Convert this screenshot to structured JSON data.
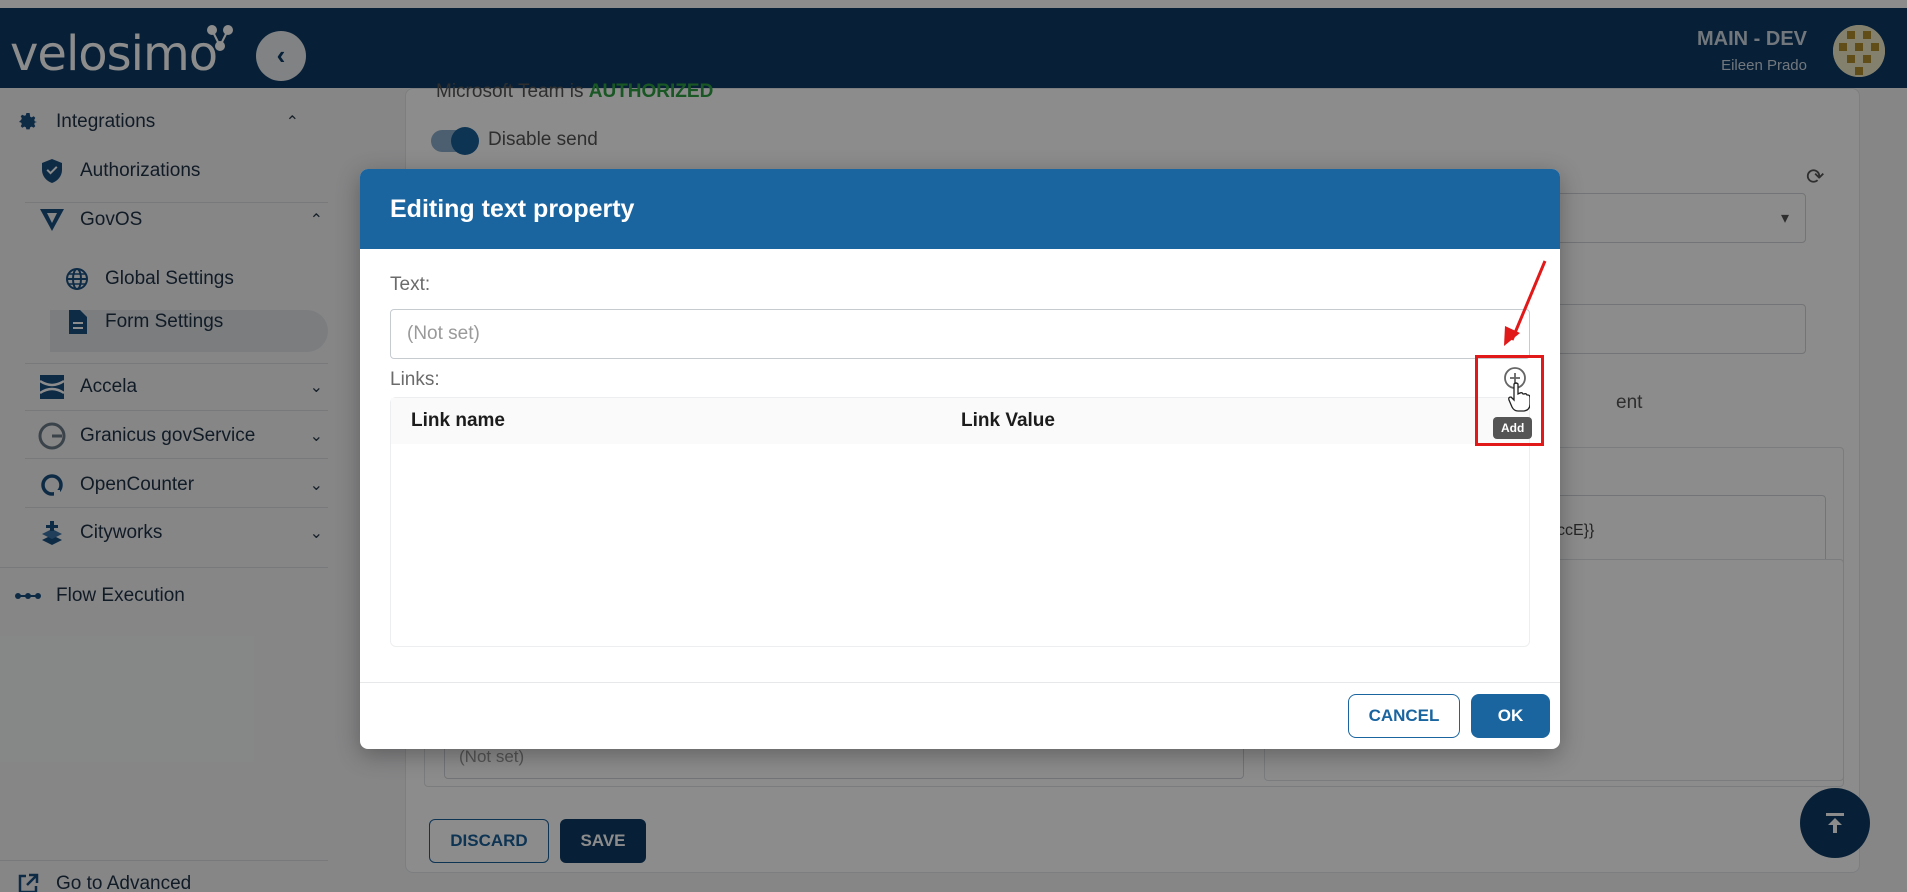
{
  "app": {
    "brand": "velosimo",
    "env_name": "MAIN - DEV",
    "user_name": "Eileen Prado"
  },
  "sidebar": {
    "integrations_label": "Integrations",
    "authorizations_label": "Authorizations",
    "govos_label": "GovOS",
    "global_settings_label": "Global Settings",
    "form_settings_label": "Form Settings",
    "accela_label": "Accela",
    "granicus_label": "Granicus govService",
    "opencounter_label": "OpenCounter",
    "cityworks_label": "Cityworks",
    "flow_execution_label": "Flow Execution",
    "go_advanced_label": "Go to Advanced"
  },
  "background": {
    "auth_status_prefix": "Microsoft Team is ",
    "auth_status_value": "AUTHORIZED",
    "disable_send_label": "Disable send",
    "partial_text_1": "ent",
    "partial_text_2": "ccE}}",
    "partial_placeholder": "(Not set)",
    "discard_label": "DISCARD",
    "save_label": "SAVE"
  },
  "modal": {
    "title": "Editing text property",
    "text_label": "Text:",
    "text_placeholder": "(Not set)",
    "links_label": "Links:",
    "col_link_name": "Link name",
    "col_link_value": "Link Value",
    "add_tooltip": "Add",
    "cancel_label": "CANCEL",
    "ok_label": "OK"
  },
  "colors": {
    "topbar": "#0d3b64",
    "modal_header": "#1a65a0",
    "highlight": "#e11919",
    "authorized_green": "#2e9e44"
  },
  "icons": [
    "chevron-left-icon",
    "gear-icon",
    "shield-icon",
    "govos-icon",
    "globe-icon",
    "document-icon",
    "accela-icon",
    "granicus-icon",
    "opencounter-icon",
    "cityworks-icon",
    "flow-icon",
    "external-link-icon",
    "refresh-icon",
    "plus-circle-icon",
    "scroll-top-icon"
  ]
}
